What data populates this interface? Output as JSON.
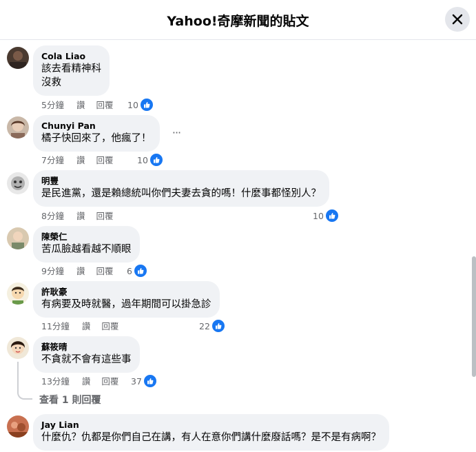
{
  "header": {
    "title": "Yahoo!奇摩新聞的貼文"
  },
  "comments": [
    {
      "author": "Cola Liao",
      "lines": [
        "該去看精神科",
        "沒救"
      ],
      "time": "5分鐘",
      "like": "讚",
      "reply": "回覆",
      "reactions": "10"
    },
    {
      "author": "Chunyi Pan",
      "lines": [
        "橘子快回來了，他瘋了！"
      ],
      "time": "7分鐘",
      "like": "讚",
      "reply": "回覆",
      "reactions": "10",
      "more": "···"
    },
    {
      "author": "明豐",
      "lines": [
        "是民進黨，還是賴總統叫你們夫妻去貪的嗎！什麼事都怪別人？"
      ],
      "time": "8分鐘",
      "like": "讚",
      "reply": "回覆",
      "reactions": "10"
    },
    {
      "author": "陳榮仁",
      "lines": [
        "苦瓜臉越看越不順眼"
      ],
      "time": "9分鐘",
      "like": "讚",
      "reply": "回覆",
      "reactions": "6"
    },
    {
      "author": "許耿豪",
      "lines": [
        "有病要及時就醫，過年期間可以掛急診"
      ],
      "time": "11分鐘",
      "like": "讚",
      "reply": "回覆",
      "reactions": "22"
    },
    {
      "author": "蘇筱晴",
      "lines": [
        "不貪就不會有這些事"
      ],
      "time": "13分鐘",
      "like": "讚",
      "reply": "回覆",
      "reactions": "37",
      "view_replies": "查看 1 則回覆"
    },
    {
      "author": "Jay Lian",
      "lines": [
        "什麼仇？仇都是你們自己在講，有人在意你們講什麼廢話嗎？是不是有病啊？"
      ]
    }
  ],
  "colors": {
    "like_blue": "#1877f2",
    "bubble_gray": "#f0f2f5",
    "meta_gray": "#65676b"
  },
  "icons": {
    "close": "close-icon",
    "like": "thumbs-up-icon",
    "more": "more-horizontal-icon"
  }
}
